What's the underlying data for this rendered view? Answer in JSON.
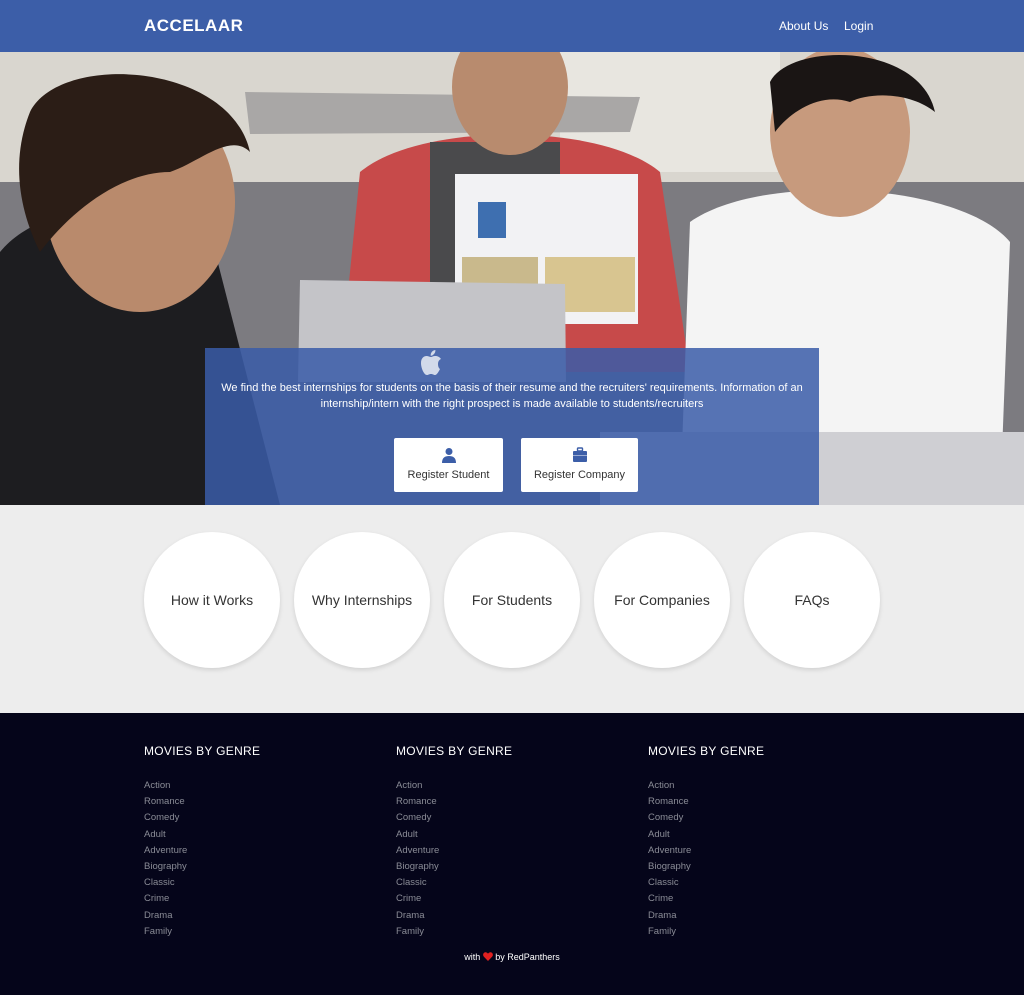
{
  "navbar": {
    "brand": "ACCELAAR",
    "links": [
      "About Us",
      "Login"
    ]
  },
  "hero": {
    "description": "We find the best internships for students on the basis of their resume and the recruiters' requirements. Information of an internship/intern with the right prospect is made available to students/recruiters",
    "buttons": [
      {
        "label": "Register Student",
        "icon": "user-icon"
      },
      {
        "label": "Register Company",
        "icon": "briefcase-icon"
      }
    ]
  },
  "circles": [
    "How it Works",
    "Why Internships",
    "For Students",
    "For Companies",
    "FAQs"
  ],
  "footer": {
    "columns": [
      {
        "heading": "MOVIES BY GENRE",
        "links": [
          "Action",
          "Romance",
          "Comedy",
          "Adult",
          "Adventure",
          "Biography",
          "Classic",
          "Crime",
          "Drama",
          "Family"
        ]
      },
      {
        "heading": "MOVIES BY GENRE",
        "links": [
          "Action",
          "Romance",
          "Comedy",
          "Adult",
          "Adventure",
          "Biography",
          "Classic",
          "Crime",
          "Drama",
          "Family"
        ]
      },
      {
        "heading": "MOVIES BY GENRE",
        "links": [
          "Action",
          "Romance",
          "Comedy",
          "Adult",
          "Adventure",
          "Biography",
          "Classic",
          "Crime",
          "Drama",
          "Family"
        ]
      }
    ],
    "credit_prefix": "with",
    "credit_suffix": "by RedPanthers"
  },
  "colors": {
    "navbar": "#3c5ea8",
    "overlay": "#3a5ca8",
    "footer": "#05051a",
    "heart": "#e02020"
  }
}
